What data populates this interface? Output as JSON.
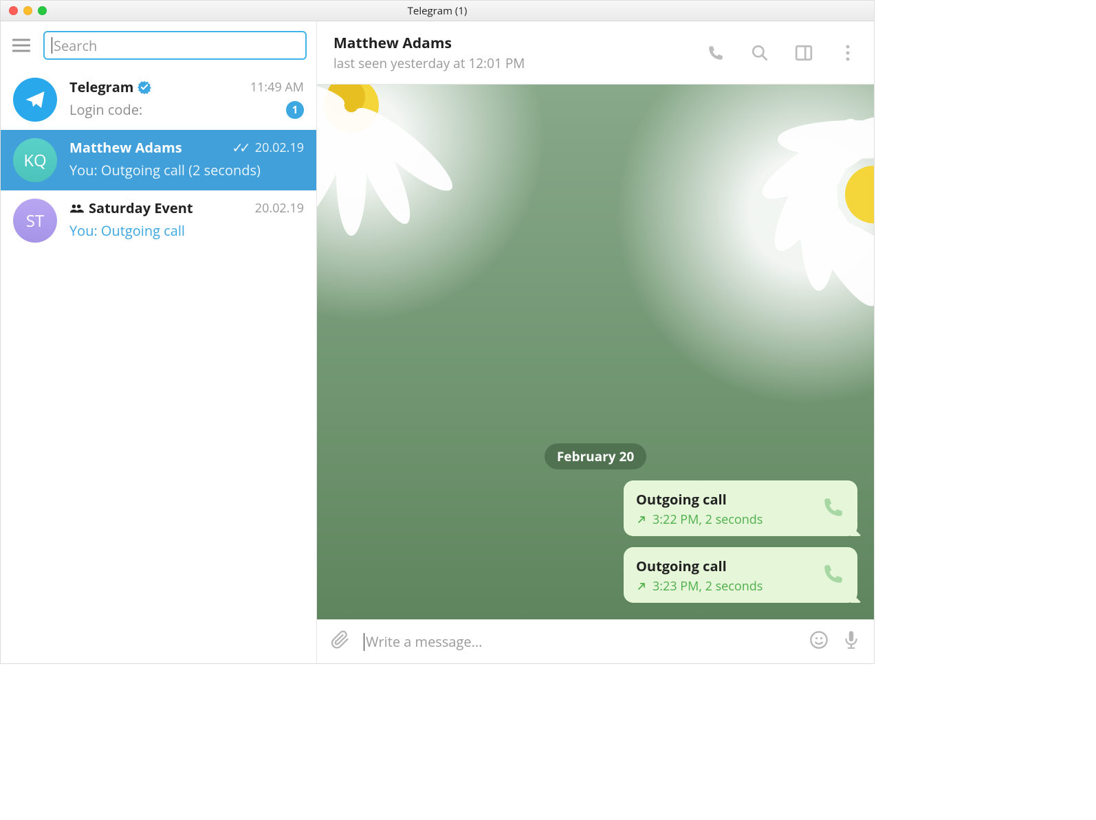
{
  "titlebar": {
    "title": "Telegram (1)"
  },
  "sidebar": {
    "search_placeholder": "Search",
    "chats": [
      {
        "name": "Telegram",
        "time": "11:49 AM",
        "preview": "Login code:",
        "badge": "1"
      },
      {
        "name": "Matthew Adams",
        "time": "20.02.19",
        "preview": "You: Outgoing call (2 seconds)"
      },
      {
        "name": "Saturday Event",
        "time": "20.02.19",
        "preview": "You: Outgoing call"
      }
    ]
  },
  "conversation": {
    "name": "Matthew Adams",
    "status": "last seen yesterday at 12:01 PM",
    "date_label": "February 20",
    "calls": [
      {
        "title": "Outgoing call",
        "meta": "3:22 PM, 2 seconds"
      },
      {
        "title": "Outgoing call",
        "meta": "3:23 PM, 2 seconds"
      }
    ]
  },
  "composer": {
    "placeholder": "Write a message..."
  }
}
